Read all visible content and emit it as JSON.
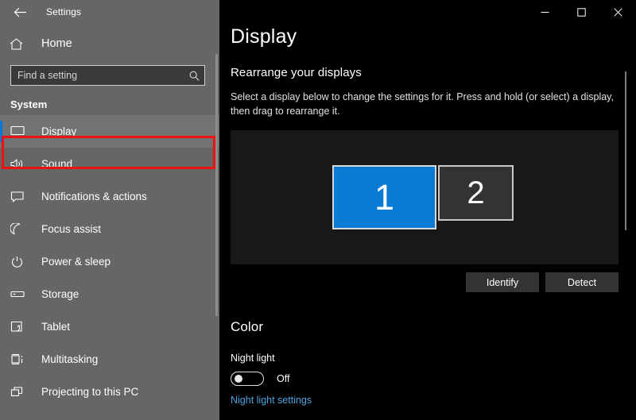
{
  "sidebar": {
    "back_icon": "back-arrow-icon",
    "title": "Settings",
    "home": {
      "label": "Home",
      "icon": "home-icon"
    },
    "search": {
      "placeholder": "Find a setting",
      "value": "",
      "icon": "search-icon"
    },
    "group_title": "System",
    "items": [
      {
        "label": "Display",
        "icon": "monitor-icon",
        "selected": true
      },
      {
        "label": "Sound",
        "icon": "speaker-icon",
        "selected": false
      },
      {
        "label": "Notifications & actions",
        "icon": "notification-icon",
        "selected": false
      },
      {
        "label": "Focus assist",
        "icon": "moon-icon",
        "selected": false
      },
      {
        "label": "Power & sleep",
        "icon": "power-icon",
        "selected": false
      },
      {
        "label": "Storage",
        "icon": "drive-icon",
        "selected": false
      },
      {
        "label": "Tablet",
        "icon": "tablet-icon",
        "selected": false
      },
      {
        "label": "Multitasking",
        "icon": "multitasking-icon",
        "selected": false
      },
      {
        "label": "Projecting to this PC",
        "icon": "projecting-icon",
        "selected": false
      }
    ]
  },
  "window_controls": {
    "minimize": "minimize-icon",
    "maximize": "maximize-icon",
    "close": "close-icon"
  },
  "main": {
    "page_title": "Display",
    "section_heading": "Rearrange your displays",
    "section_description": "Select a display below to change the settings for it. Press and hold (or select) a display, then drag to rearrange it.",
    "displays": [
      {
        "number": "1",
        "selected": true
      },
      {
        "number": "2",
        "selected": false
      }
    ],
    "identify_button": "Identify",
    "detect_button": "Detect",
    "color_heading": "Color",
    "night_light_label": "Night light",
    "night_light_state": "Off",
    "night_light_settings_link": "Night light settings"
  },
  "colors": {
    "accent": "#0078d7",
    "sidebar_bg": "#666666",
    "content_bg": "#000000",
    "highlight_box": "#ee1111",
    "display_canvas": "#18181a",
    "link": "#4aa3e0"
  }
}
